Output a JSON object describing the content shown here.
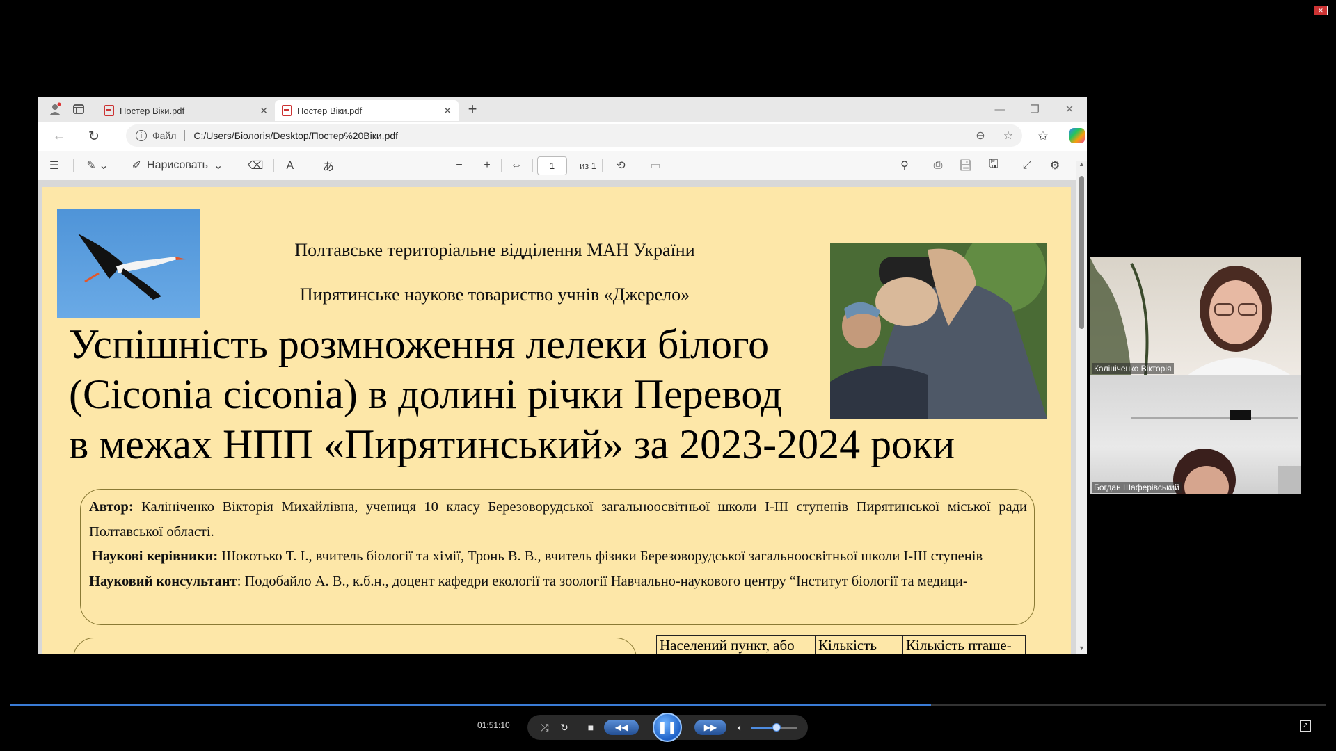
{
  "browser": {
    "tabs": [
      {
        "title": "Постер Віки.pdf",
        "active": false
      },
      {
        "title": "Постер Віки.pdf",
        "active": true
      }
    ],
    "new_tab": "+",
    "address": {
      "file_label": "Файл",
      "url": "C:/Users/Біологія/Desktop/Постер%20Віки.pdf"
    }
  },
  "pdf_toolbar": {
    "draw_label": "Нарисовать",
    "page_current": "1",
    "page_total": "из 1"
  },
  "poster": {
    "header_line1": "Полтавське територіальне відділення МАН України",
    "header_line2": "Пирятинське наукове товариство учнів «Джерело»",
    "title_line1": "Успішність розмноження лелеки білого",
    "title_line2": "(Ciconia ciconia) в долині річки Перевод",
    "title_line3": "в межах НПП «Пирятинський» за 2023-2024 роки",
    "author_label": "Автор:",
    "author_text": " Калініченко Вікторія Михайлівна, учениця 10 класу Березоворудської загальноосвітньої школи І-ІІІ ступенів Пирятинської міської ради Полтавської області.",
    "supervisors_label": "Наукові керівники:",
    "supervisors_text": " Шокотько Т. І., вчитель біології та хімії, Тронь В. В., вчитель фізики Березоворудської загальноосвітньої школи І-ІІІ ступенів",
    "consultant_label": "Науковий консультант",
    "consultant_text": ": Подобайло А. В., к.б.н., доцент кафедри екології та зоології Навчально-наукового центру “Інститут біології та медици-",
    "table_headers": [
      "Населений пункт, або",
      "Кількість",
      "Кількість пташе-"
    ]
  },
  "participants": [
    {
      "name": "Калініченко Вікторія"
    },
    {
      "name": "Богдан Шаферівський"
    }
  ],
  "player": {
    "timecode": "01:51:10",
    "progress": 0.7
  },
  "colors": {
    "poster_bg": "#fde7a8",
    "accent": "#3a7bd5"
  }
}
